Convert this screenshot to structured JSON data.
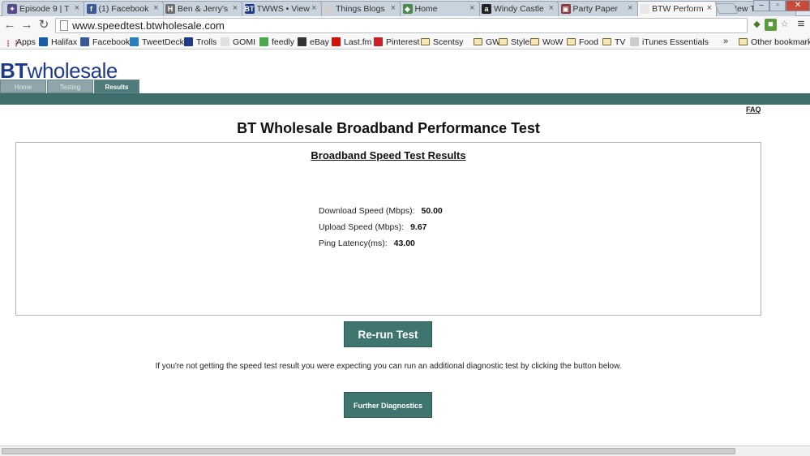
{
  "browser": {
    "tabs": [
      {
        "title": "Episode 9 | T",
        "fav": "✦",
        "color": "#5a4a8a"
      },
      {
        "title": "(1) Facebook",
        "fav": "f",
        "color": "#3b5998"
      },
      {
        "title": "Ben & Jerry's",
        "fav": "H",
        "color": "#6d6d6d"
      },
      {
        "title": "TWWS • View",
        "fav": "BT",
        "color": "#1f3a8a"
      },
      {
        "title": "Things Blogs",
        "fav": "",
        "color": "#d0d0d0"
      },
      {
        "title": "Home",
        "fav": "◆",
        "color": "#4a8a4a"
      },
      {
        "title": "Windy Castle",
        "fav": "a",
        "color": "#222222"
      },
      {
        "title": "Party Paper",
        "fav": "▣",
        "color": "#8a3a3a"
      },
      {
        "title": "BTW Perform",
        "fav": "",
        "color": "#e8e8e8"
      },
      {
        "title": "New Tab",
        "fav": "",
        "color": "#e8e8e8"
      }
    ],
    "active_tab": 8,
    "url": "www.speedtest.btwholesale.com",
    "bookmarks": [
      {
        "label": "Apps",
        "kind": "apps"
      },
      {
        "label": "Halifax",
        "kind": "icon",
        "color": "#1b5aa6"
      },
      {
        "label": "Facebook",
        "kind": "icon",
        "color": "#3b5998"
      },
      {
        "label": "TweetDeck",
        "kind": "icon",
        "color": "#2a7fbf"
      },
      {
        "label": "Trolls",
        "kind": "icon",
        "color": "#1f3a8a"
      },
      {
        "label": "GOMI",
        "kind": "icon",
        "color": "#e0e0e0"
      },
      {
        "label": "feedly",
        "kind": "icon",
        "color": "#4ca84c"
      },
      {
        "label": "eBay",
        "kind": "icon",
        "color": "#333333"
      },
      {
        "label": "Last.fm",
        "kind": "icon",
        "color": "#d51007"
      },
      {
        "label": "Pinterest",
        "kind": "icon",
        "color": "#cb2027"
      },
      {
        "label": "Scentsy",
        "kind": "folder"
      },
      {
        "label": "GW",
        "kind": "folder"
      },
      {
        "label": "Style",
        "kind": "folder"
      },
      {
        "label": "WoW",
        "kind": "folder"
      },
      {
        "label": "Food",
        "kind": "folder"
      },
      {
        "label": "TV",
        "kind": "folder"
      },
      {
        "label": "iTunes Essentials",
        "kind": "icon",
        "color": "#cccccc"
      }
    ],
    "other_bookmarks": "Other bookmarks",
    "overflow": "»"
  },
  "site": {
    "logo_bt": "BT",
    "logo_rest": "wholesale",
    "nav": [
      "Home",
      "Testing",
      "Results"
    ],
    "nav_active": 2,
    "faq": "FAQ"
  },
  "main": {
    "title": "BT Wholesale Broadband Performance Test",
    "results_heading": "Broadband Speed Test Results",
    "metrics": [
      {
        "label": "Download Speed (Mbps):",
        "value": "50.00"
      },
      {
        "label": "Upload Speed (Mbps):",
        "value": "9.67"
      },
      {
        "label": "Ping Latency(ms):",
        "value": "43.00"
      }
    ],
    "rerun_label": "Re-run Test",
    "info_text": "If you're not getting the speed test result you were expecting you can run an additional diagnostic test by clicking the button below.",
    "diagnostics_label": "Further Diagnostics"
  }
}
